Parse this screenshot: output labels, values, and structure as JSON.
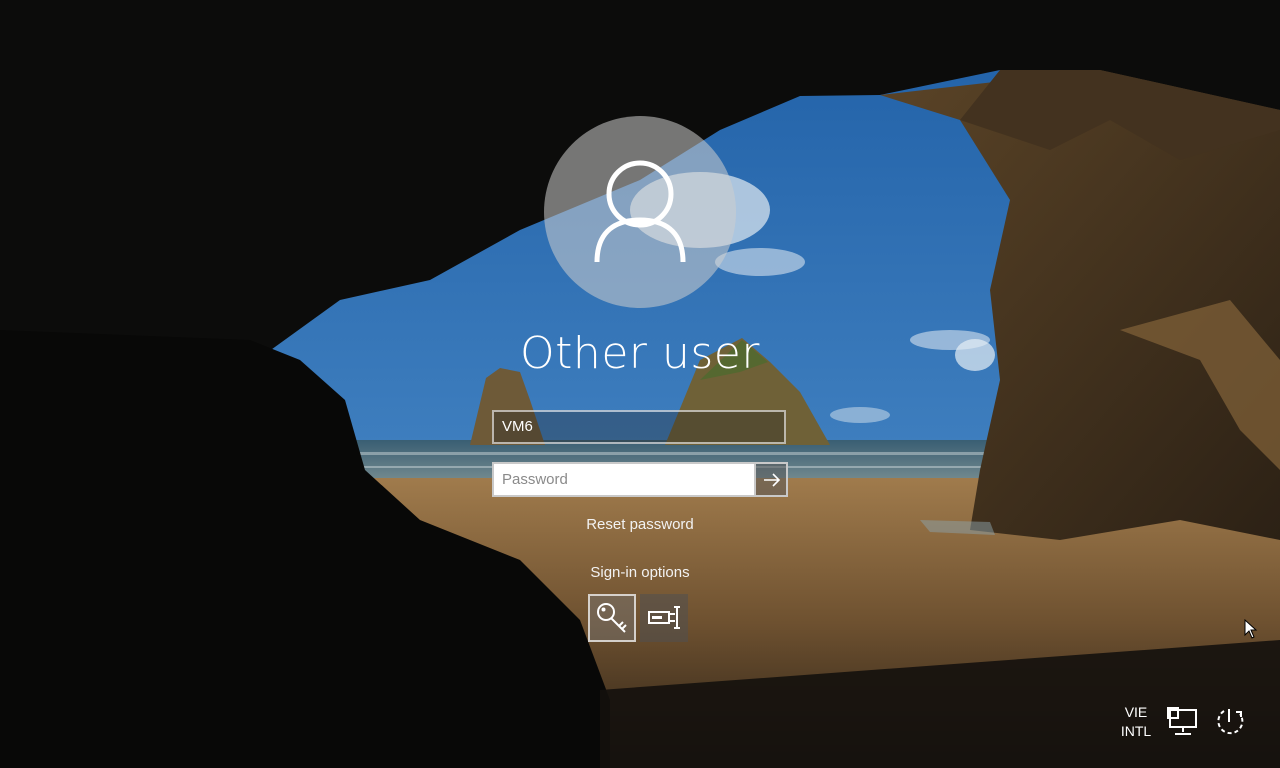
{
  "user": {
    "display_name": "Other user",
    "avatar_icon": "user-silhouette-icon"
  },
  "login_form": {
    "username_value": "VM6",
    "password_placeholder": "Password",
    "submit_icon": "arrow-right-icon"
  },
  "links": {
    "reset_password": "Reset password",
    "sign_in_options": "Sign-in options"
  },
  "sign_in_options": [
    {
      "name": "password",
      "icon": "key-icon",
      "selected": true
    },
    {
      "name": "smart-card",
      "icon": "smart-card-icon",
      "selected": false
    }
  ],
  "tray": {
    "language_line1": "VIE",
    "language_line2": "INTL",
    "network_icon": "network-icon",
    "power_icon": "power-icon"
  },
  "colors": {
    "text": "#ffffff",
    "password_background": "#ffffff",
    "sky": "#2f6fb3",
    "sand": "#8c6a3f"
  }
}
